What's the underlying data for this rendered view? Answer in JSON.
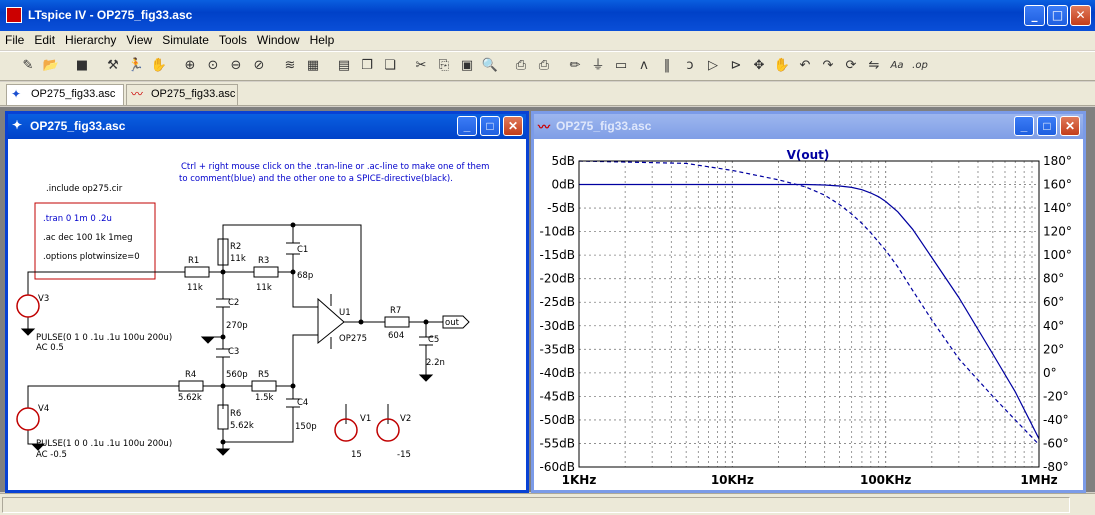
{
  "app": {
    "title": "LTspice IV - OP275_fig33.asc"
  },
  "menu": [
    "File",
    "Edit",
    "Hierarchy",
    "View",
    "Simulate",
    "Tools",
    "Window",
    "Help"
  ],
  "toolbar_icons": [
    "new-schematic-icon",
    "open-icon",
    "save-icon",
    "control-panel-icon",
    "run-icon",
    "halt-icon",
    "zoom-in-icon",
    "zoom-pan-icon",
    "zoom-out-icon",
    "zoom-cancel-icon",
    "autorange-icon",
    "mark-unused-icon",
    "tile-horizontal-icon",
    "cascade-icon",
    "close-all-icon",
    "cut-icon",
    "copy-icon",
    "paste-icon",
    "find-icon",
    "print-setup-icon",
    "print-icon",
    "draw-wire-icon",
    "ground-icon",
    "label-net-icon",
    "resistor-icon",
    "capacitor-icon",
    "inductor-icon",
    "diode-icon",
    "component-icon",
    "move-icon",
    "drag-icon",
    "undo-icon",
    "redo-icon",
    "rotate-icon",
    "mirror-icon",
    "text-icon",
    "spice-directive-icon"
  ],
  "tabs": [
    {
      "label": "OP275_fig33.asc",
      "icon": "schematic-icon"
    },
    {
      "label": "OP275_fig33.asc",
      "icon": "waveform-icon"
    }
  ],
  "schematic": {
    "title": "OP275_fig33.asc",
    "include": ".include op275.cir",
    "note_line1": "Ctrl + right mouse click on the .tran-line or .ac-line to make one of them",
    "note_line2": "to comment(blue) and the other one to a SPICE-directive(black).",
    "directives": [
      ".tran 0 1m 0 .2u",
      ".ac dec 100 1k 1meg",
      ".options plotwinsize=0"
    ],
    "components": {
      "R1": {
        "name": "R1",
        "value": "11k"
      },
      "R2": {
        "name": "R2",
        "value": "11k"
      },
      "R3": {
        "name": "R3",
        "value": "11k"
      },
      "R4": {
        "name": "R4",
        "value": "5.62k"
      },
      "R5": {
        "name": "R5",
        "value": "1.5k"
      },
      "R6": {
        "name": "R6",
        "value": "5.62k"
      },
      "R7": {
        "name": "R7",
        "value": "604"
      },
      "C1": {
        "name": "C1",
        "value": "68p"
      },
      "C2": {
        "name": "C2",
        "value": "270p"
      },
      "C3": {
        "name": "C3",
        "value": "560p"
      },
      "C4": {
        "name": "C4",
        "value": "150p"
      },
      "C5": {
        "name": "C5",
        "value": "2.2n"
      },
      "U1": {
        "name": "U1",
        "value": "OP275"
      },
      "V1": {
        "name": "V1",
        "value": "15"
      },
      "V2": {
        "name": "V2",
        "value": "-15"
      },
      "V3": {
        "name": "V3",
        "value": "PULSE(0 1 0 .1u .1u 100u 200u)",
        "ac": "AC 0.5"
      },
      "V4": {
        "name": "V4",
        "value": "PULSE(1 0 0 .1u .1u 100u 200u)",
        "ac": "AC -0.5"
      }
    },
    "out_label": "out"
  },
  "waveform": {
    "title": "OP275_fig33.asc",
    "trace_label": "V(out)",
    "trace_color": "#0000a0"
  },
  "chart_data": {
    "type": "line",
    "title": "V(out)",
    "x_scale": "log",
    "x": [
      1000,
      5000,
      10000,
      20000,
      30000,
      40000,
      50000,
      60000,
      70000,
      80000,
      90000,
      100000,
      120000,
      150000,
      200000,
      300000,
      500000,
      700000,
      1000000
    ],
    "x_ticks": [
      "1KHz",
      "10KHz",
      "100KHz",
      "1MHz"
    ],
    "xlim": [
      1000,
      1000000
    ],
    "y_left_ticks": [
      "5dB",
      "0dB",
      "-5dB",
      "-10dB",
      "-15dB",
      "-20dB",
      "-25dB",
      "-30dB",
      "-35dB",
      "-40dB",
      "-45dB",
      "-50dB",
      "-55dB",
      "-60dB"
    ],
    "ylim_left": [
      -60,
      5
    ],
    "y_right_ticks": [
      "180°",
      "160°",
      "140°",
      "120°",
      "100°",
      "80°",
      "60°",
      "40°",
      "20°",
      "0°",
      "-20°",
      "-40°",
      "-60°",
      "-80°"
    ],
    "ylim_right": [
      -80,
      180
    ],
    "grid": true,
    "series": [
      {
        "name": "magnitude",
        "axis": "left",
        "style": "solid",
        "values": [
          0,
          0,
          0,
          0,
          0,
          -0.1,
          -0.3,
          -0.6,
          -1.1,
          -1.8,
          -2.6,
          -3.6,
          -5.8,
          -9.5,
          -15.5,
          -24,
          -36,
          -44,
          -54
        ]
      },
      {
        "name": "phase",
        "axis": "right",
        "style": "dashed",
        "values": [
          180,
          178,
          172,
          164,
          158,
          151,
          143,
          135,
          127,
          119,
          111,
          104,
          90,
          70,
          45,
          12,
          -20,
          -40,
          -61
        ]
      }
    ]
  }
}
